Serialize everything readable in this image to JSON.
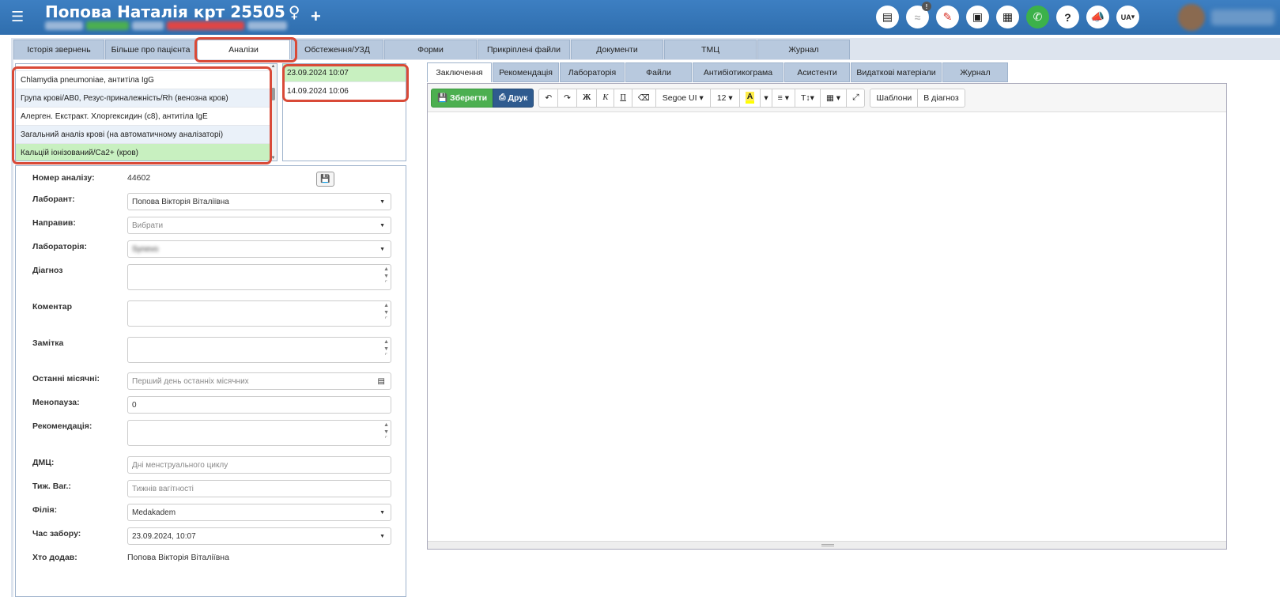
{
  "header": {
    "title": "Попова Наталія крт 25505",
    "gender_symbol": "♀",
    "add_symbol": "+",
    "lang": "UA",
    "notification_count": "!"
  },
  "main_tabs": [
    {
      "label": "Історія звернень"
    },
    {
      "label": "Більше про пацієнта"
    },
    {
      "label": "Аналізи"
    },
    {
      "label": "Обстеження/УЗД"
    },
    {
      "label": "Форми"
    },
    {
      "label": "Прикріплені файли"
    },
    {
      "label": "Документи"
    },
    {
      "label": "ТМЦ"
    },
    {
      "label": "Журнал"
    }
  ],
  "analyses": [
    {
      "label": "Chlamydia pneumoniae, антитіла IgG"
    },
    {
      "label": "Група крові/AB0, Резус-приналежність/Rh (венозна кров)"
    },
    {
      "label": "Алерген. Екстракт. Хлоргексидин (с8), антитіла IgE"
    },
    {
      "label": "Загальний аналіз крові (на автоматичному аналізаторі)"
    },
    {
      "label": "Кальцій іонізований/Ca2+ (кров)"
    }
  ],
  "dates": [
    {
      "label": "23.09.2024 10:07"
    },
    {
      "label": "14.09.2024 10:06"
    }
  ],
  "form": {
    "analysis_number_label": "Номер аналізу:",
    "analysis_number": "44602",
    "laborant_label": "Лаборант:",
    "laborant_value": "Попова Вікторія Віталіївна",
    "referred_label": "Направив:",
    "referred_placeholder": "Вибрати",
    "laboratory_label": "Лабораторія:",
    "laboratory_value": "Synevo",
    "diagnosis_label": "Діагноз",
    "comment_label": "Коментар",
    "note_label": "Замітка",
    "last_menses_label": "Останні місячні:",
    "last_menses_placeholder": "Перший день останніх місячних",
    "menopause_label": "Менопауза:",
    "menopause_value": "0",
    "recommendation_label": "Рекомендація:",
    "dmc_label": "ДМЦ:",
    "dmc_placeholder": "Дні менструального циклу",
    "pregnancy_label": "Тиж. Ваг.:",
    "pregnancy_placeholder": "Тижнів вагітності",
    "branch_label": "Філія:",
    "branch_value": "Medakadem",
    "collection_time_label": "Час забору:",
    "collection_time_value": "23.09.2024, 10:07",
    "added_by_label": "Хто додав:",
    "added_by_value": "Попова Вікторія Віталіївна"
  },
  "editor_tabs": [
    {
      "label": "Заключення"
    },
    {
      "label": "Рекомендація"
    },
    {
      "label": "Лабораторія"
    },
    {
      "label": "Файли"
    },
    {
      "label": "Антибіотикограма"
    },
    {
      "label": "Асистенти"
    },
    {
      "label": "Видаткові матеріали"
    },
    {
      "label": "Журнал"
    }
  ],
  "toolbar": {
    "save": "Зберегти",
    "print": "Друк",
    "undo": "↶",
    "redo": "↷",
    "bold": "Ж",
    "italic": "К",
    "underline": "П",
    "eraser": "⌫",
    "font": "Segoe UI",
    "size": "12",
    "highlight": "A",
    "align": "≡",
    "text_format": "T↕",
    "table": "▦",
    "fullscreen": "⤢",
    "templates": "Шаблони",
    "to_diagnosis": "В діагноз"
  }
}
